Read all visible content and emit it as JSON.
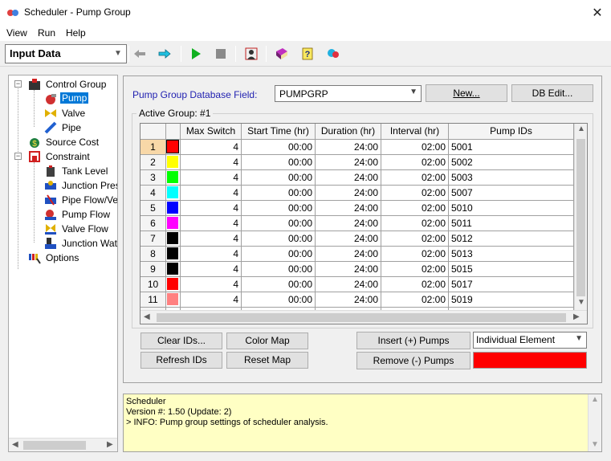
{
  "window": {
    "title": "Scheduler - Pump Group"
  },
  "menu": [
    "View",
    "Run",
    "Help"
  ],
  "toolbar": {
    "mode": "Input Data",
    "icons": [
      "back-arrow-icon",
      "forward-arrow-icon",
      "play-icon",
      "stop-icon",
      "person-icon",
      "book-icon",
      "help-icon",
      "settings-icon"
    ]
  },
  "tree": {
    "items": [
      {
        "label": "Control Group",
        "icon": "control-group-icon"
      },
      {
        "label": "Pump",
        "icon": "pump-icon",
        "selected": true
      },
      {
        "label": "Valve",
        "icon": "valve-icon"
      },
      {
        "label": "Pipe",
        "icon": "pipe-icon"
      },
      {
        "label": "Source Cost",
        "icon": "source-cost-icon"
      },
      {
        "label": "Constraint",
        "icon": "constraint-icon"
      },
      {
        "label": "Tank Level",
        "icon": "tank-level-icon"
      },
      {
        "label": "Junction Pres",
        "icon": "junction-pressure-icon"
      },
      {
        "label": "Pipe Flow/Ve",
        "icon": "pipe-flow-icon"
      },
      {
        "label": "Pump Flow",
        "icon": "pump-flow-icon"
      },
      {
        "label": "Valve Flow",
        "icon": "valve-flow-icon"
      },
      {
        "label": "Junction Wat",
        "icon": "junction-water-icon"
      },
      {
        "label": "Options",
        "icon": "options-icon"
      }
    ]
  },
  "group": {
    "db_field_label": "Pump Group Database Field:",
    "db_field_value": "PUMPGRP",
    "new_button": "New...",
    "db_edit_button": "DB Edit...",
    "active_group_label": "Active Group: #1",
    "columns": [
      "",
      "",
      "Max Switch",
      "Start Time (hr)",
      "Duration (hr)",
      "Interval (hr)",
      "Pump IDs"
    ],
    "rows": [
      {
        "n": "1",
        "color": "#ff0000",
        "max": "4",
        "start": "00:00",
        "dur": "24:00",
        "int": "02:00",
        "ids": "5001"
      },
      {
        "n": "2",
        "color": "#ffff00",
        "max": "4",
        "start": "00:00",
        "dur": "24:00",
        "int": "02:00",
        "ids": "5002"
      },
      {
        "n": "3",
        "color": "#00ff00",
        "max": "4",
        "start": "00:00",
        "dur": "24:00",
        "int": "02:00",
        "ids": "5003"
      },
      {
        "n": "4",
        "color": "#00ffff",
        "max": "4",
        "start": "00:00",
        "dur": "24:00",
        "int": "02:00",
        "ids": "5007"
      },
      {
        "n": "5",
        "color": "#0000ff",
        "max": "4",
        "start": "00:00",
        "dur": "24:00",
        "int": "02:00",
        "ids": "5010"
      },
      {
        "n": "6",
        "color": "#ff00ff",
        "max": "4",
        "start": "00:00",
        "dur": "24:00",
        "int": "02:00",
        "ids": "5011"
      },
      {
        "n": "7",
        "color": "#000000",
        "max": "4",
        "start": "00:00",
        "dur": "24:00",
        "int": "02:00",
        "ids": "5012"
      },
      {
        "n": "8",
        "color": "#000000",
        "max": "4",
        "start": "00:00",
        "dur": "24:00",
        "int": "02:00",
        "ids": "5013"
      },
      {
        "n": "9",
        "color": "#000000",
        "max": "4",
        "start": "00:00",
        "dur": "24:00",
        "int": "02:00",
        "ids": "5015"
      },
      {
        "n": "10",
        "color": "#ff0000",
        "max": "4",
        "start": "00:00",
        "dur": "24:00",
        "int": "02:00",
        "ids": "5017"
      },
      {
        "n": "11",
        "color": "#ff8080",
        "max": "4",
        "start": "00:00",
        "dur": "24:00",
        "int": "02:00",
        "ids": "5019"
      }
    ],
    "clear_ids_button": "Clear IDs...",
    "color_map_button": "Color Map",
    "refresh_ids_button": "Refresh IDs",
    "reset_map_button": "Reset Map",
    "insert_pumps_button": "Insert (+) Pumps",
    "remove_pumps_button": "Remove (-) Pumps",
    "element_mode": "Individual Element",
    "swatch_color": "#ff0000"
  },
  "log": {
    "lines": [
      "Scheduler",
      "Version #: 1.50 (Update: 2)",
      "> INFO: Pump group settings of scheduler analysis."
    ]
  }
}
